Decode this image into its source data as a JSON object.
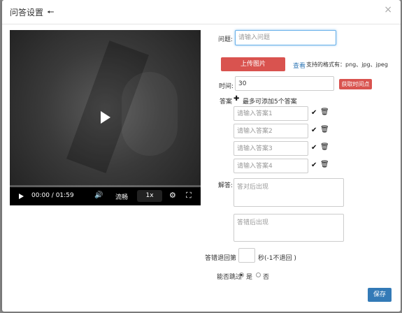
{
  "header": {
    "title": "问答设置",
    "back_icon": "arrow-left-icon",
    "close": "×"
  },
  "video": {
    "time": "00:00 / 01:59",
    "quality": "流畅",
    "speed": "1x"
  },
  "form": {
    "question_label": "问题:",
    "question_placeholder": "请输入问题",
    "upload_label": "上传图片",
    "view_label": "查看",
    "formats_label": "支持的格式有：png、jpg、jpeg",
    "time_label": "时间:",
    "time_value": "30",
    "get_time_label": "获取时间点",
    "answer_label": "答案",
    "add_answer_label": "最多可添加5个答案",
    "answers": [
      {
        "placeholder": "请输入答案1"
      },
      {
        "placeholder": "请输入答案2"
      },
      {
        "placeholder": "请输入答案3"
      },
      {
        "placeholder": "请输入答案4"
      }
    ],
    "explain_label": "解答:",
    "correct_placeholder": "答对后出现",
    "wrong_placeholder": "答错后出现",
    "rewind_label": "答错退回第",
    "rewind_suffix": "秒(-1不退回 )",
    "skip_label": "能否跳过",
    "yes_label": "是",
    "no_label": "否",
    "save_label": "保存"
  }
}
